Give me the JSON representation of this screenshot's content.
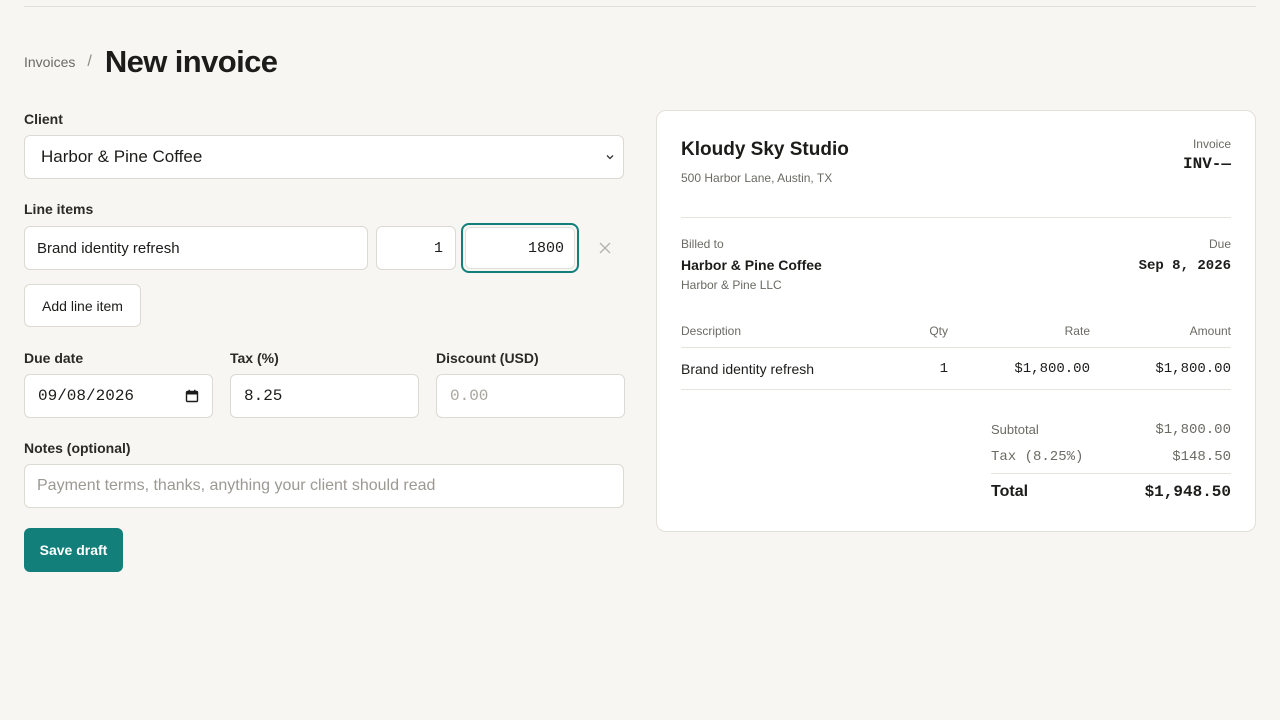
{
  "breadcrumb": {
    "parent": "Invoices",
    "separator": "/",
    "current": "New invoice"
  },
  "form": {
    "client_label": "Client",
    "client_value": "Harbor & Pine Coffee",
    "line_items_label": "Line items",
    "line_items": [
      {
        "description": "Brand identity refresh",
        "qty": "1",
        "rate": "1800"
      }
    ],
    "add_line_item": "Add line item",
    "due_date_label": "Due date",
    "due_date_value": "09/08/2026",
    "tax_label": "Tax (%)",
    "tax_value": "8.25",
    "discount_label": "Discount (USD)",
    "discount_placeholder": "0.00",
    "notes_label": "Notes (optional)",
    "notes_placeholder": "Payment terms, thanks, anything your client should read",
    "save_label": "Save draft"
  },
  "preview": {
    "studio_name": "Kloudy Sky Studio",
    "studio_address": "500 Harbor Lane, Austin, TX",
    "invoice_label": "Invoice",
    "invoice_number": "INV-—",
    "billed_to_label": "Billed to",
    "billed_to_name": "Harbor & Pine Coffee",
    "billed_to_company": "Harbor & Pine LLC",
    "due_label": "Due",
    "due_value": "Sep 8, 2026",
    "columns": {
      "description": "Description",
      "qty": "Qty",
      "rate": "Rate",
      "amount": "Amount"
    },
    "rows": [
      {
        "description": "Brand identity refresh",
        "qty": "1",
        "rate": "$1,800.00",
        "amount": "$1,800.00"
      }
    ],
    "subtotal_label": "Subtotal",
    "subtotal_value": "$1,800.00",
    "tax_label": "Tax (8.25%)",
    "tax_value": "$148.50",
    "total_label": "Total",
    "total_value": "$1,948.50"
  },
  "colors": {
    "accent": "#127f7a",
    "background": "#f7f6f2"
  },
  "icons": {
    "select_chevron": "chevron-down-icon",
    "remove": "close-icon",
    "calendar": "calendar-icon"
  }
}
